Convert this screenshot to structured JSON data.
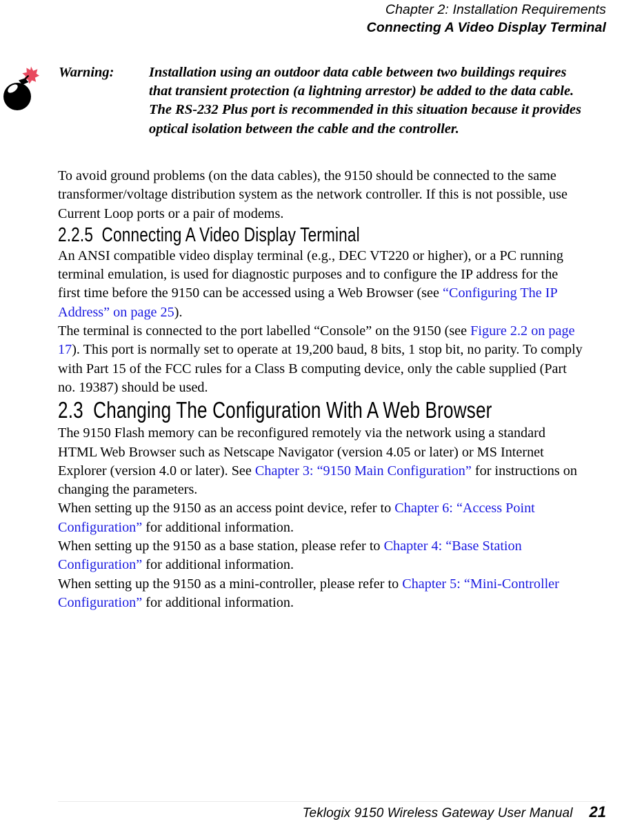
{
  "header": {
    "chapter": "Chapter 2:  Installation Requirements",
    "section": "Connecting A Video Display Terminal"
  },
  "warning": {
    "icon": "bomb-icon",
    "icon_colors": {
      "body": "#000000",
      "spark": "#e8495e"
    },
    "label": "Warning:",
    "text": "Installation using an outdoor data cable between two buildings requires that transient protection (a lightning arrestor) be added to the data cable. The RS-232 Plus port is recommended in this situation because it provides optical isolation between the cable and the controller."
  },
  "link_color": "#1a1ae0",
  "paragraph_ground": "To avoid ground problems (on the data cables), the 9150 should be connected to the same transformer/voltage distribution system as the network controller. If this is not possible, use Current Loop ports or a pair of modems.",
  "heading_225": {
    "number": "2.2.5",
    "title": "Connecting A Video Display Terminal"
  },
  "paragraph_ansi": {
    "part1": "An ANSI compatible video display terminal (e.g., DEC VT220 or higher), or a PC running terminal emulation, is used for diagnostic purposes and to configure the IP address for the first time before the 9150 can be accessed using a Web Browser (see ",
    "link": "“Configuring The IP Address” on page 25",
    "part2": ")."
  },
  "paragraph_terminal": {
    "part1": "The terminal is connected to the port labelled “Console” on the 9150 (see ",
    "link": "Figure 2.2 on page 17",
    "part2": "). This port is normally set to operate at 19,200 baud, 8 bits, 1 stop bit, no parity. To comply with Part 15 of the FCC rules for a Class B computing device, only the cable supplied (Part no. 19387) should be used."
  },
  "heading_23": {
    "number": "2.3",
    "title": "Changing The Configuration With A Web Browser"
  },
  "paragraph_flash": {
    "part1": "The 9150 Flash memory can be reconfigured remotely via the network using a standard HTML Web Browser such as Netscape Navigator (version 4.05 or later) or MS Internet Explorer (version 4.0 or later). See ",
    "link": "Chapter 3: “9150 Main Configuration”",
    "part2": " for instructions on changing the parameters."
  },
  "paragraph_access_point": {
    "part1": "When setting up the 9150 as an access point device, refer to ",
    "link": "Chapter 6: “Access Point Configuration”",
    "part2": " for additional information."
  },
  "paragraph_base_station": {
    "part1": "When setting up the 9150 as a base station, please refer to ",
    "link": "Chapter 4: “Base Station Configuration”",
    "part2": " for additional information."
  },
  "paragraph_mini_controller": {
    "part1": "When setting up the 9150 as a mini-controller, please refer to ",
    "link": "Chapter 5: “Mini-Controller Configuration”",
    "part2": " for additional information."
  },
  "footer": {
    "title": "Teklogix 9150 Wireless Gateway User Manual",
    "page_number": "21"
  }
}
